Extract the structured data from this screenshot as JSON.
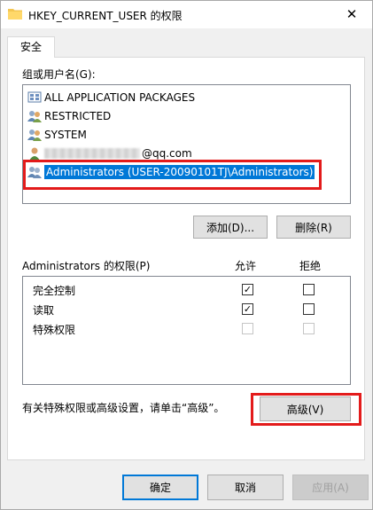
{
  "window": {
    "title": "HKEY_CURRENT_USER 的权限"
  },
  "tab": {
    "label": "安全"
  },
  "groups": {
    "label": "组或用户名(G):",
    "items": [
      {
        "label": "ALL APPLICATION PACKAGES",
        "icon": "app-packages-icon"
      },
      {
        "label": "RESTRICTED",
        "icon": "group-users-icon"
      },
      {
        "label": "SYSTEM",
        "icon": "group-users-icon"
      },
      {
        "label": "@qq.com",
        "icon": "single-user-icon"
      },
      {
        "label": "Administrators (USER-20090101TJ\\Administrators)",
        "icon": "group-users-icon"
      }
    ],
    "selected_index": 4
  },
  "buttons": {
    "add": "添加(D)...",
    "remove": "删除(R)",
    "advanced": "高级(V)",
    "ok": "确定",
    "cancel": "取消",
    "apply": "应用(A)"
  },
  "permissions": {
    "label": "Administrators 的权限(P)",
    "allow_header": "允许",
    "deny_header": "拒绝",
    "rows": [
      {
        "name": "完全控制",
        "allow": true,
        "deny": false,
        "enabled": true
      },
      {
        "name": "读取",
        "allow": true,
        "deny": false,
        "enabled": true
      },
      {
        "name": "特殊权限",
        "allow": false,
        "deny": false,
        "enabled": false
      }
    ]
  },
  "advanced_note": "有关特殊权限或高级设置，请单击“高级”。",
  "colors": {
    "selection": "#0078d7",
    "highlight_box": "#e31b1b"
  }
}
